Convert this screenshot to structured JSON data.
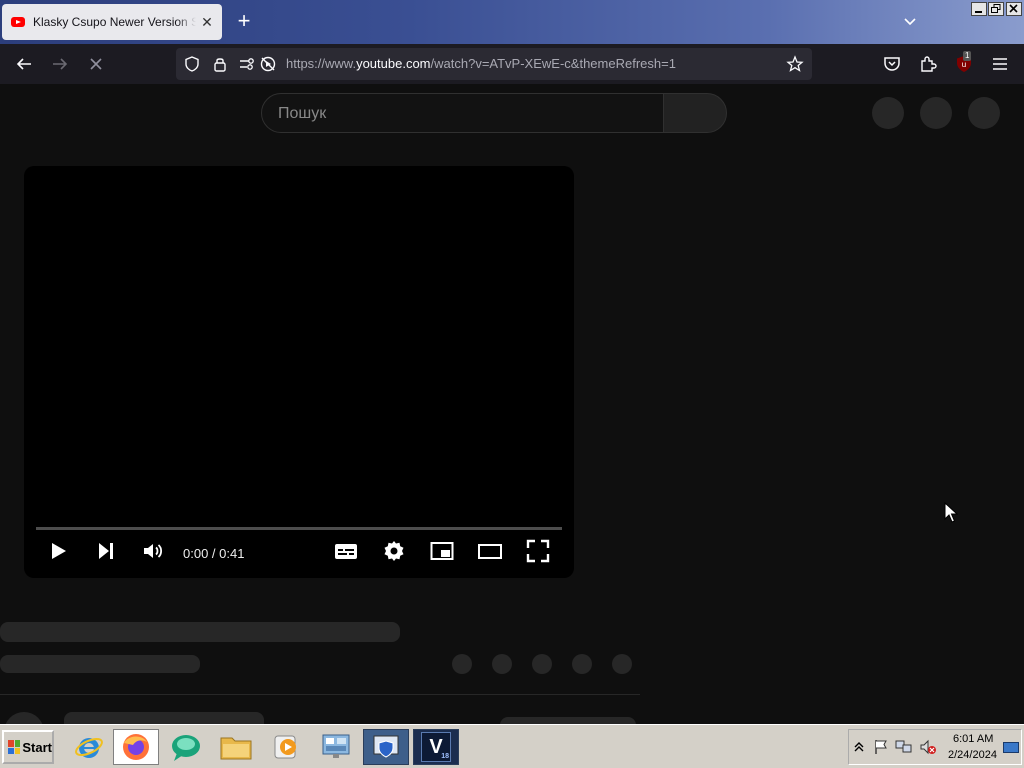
{
  "browser": {
    "tab": {
      "title": "Klasky Csupo Newer Version Scan"
    },
    "url": {
      "prefix": "https://www.",
      "host": "youtube.com",
      "path": "/watch?v=ATvP-XEwE-c&themeRefresh=1"
    },
    "notification_badge": "1"
  },
  "page": {
    "search": {
      "placeholder": "Пошук"
    },
    "player": {
      "time": "0:00 / 0:41",
      "progress": 0
    }
  },
  "taskbar": {
    "start_label": "Start",
    "clock": {
      "time": "6:01 AM",
      "date": "2/24/2024"
    },
    "vegas_badge": "V",
    "vegas_version": "18"
  },
  "colors": {
    "page_bg": "#0f0f0f",
    "skeleton": "#272727",
    "youtube_red": "#ff0000",
    "taskbar": "#d4d0c8"
  }
}
